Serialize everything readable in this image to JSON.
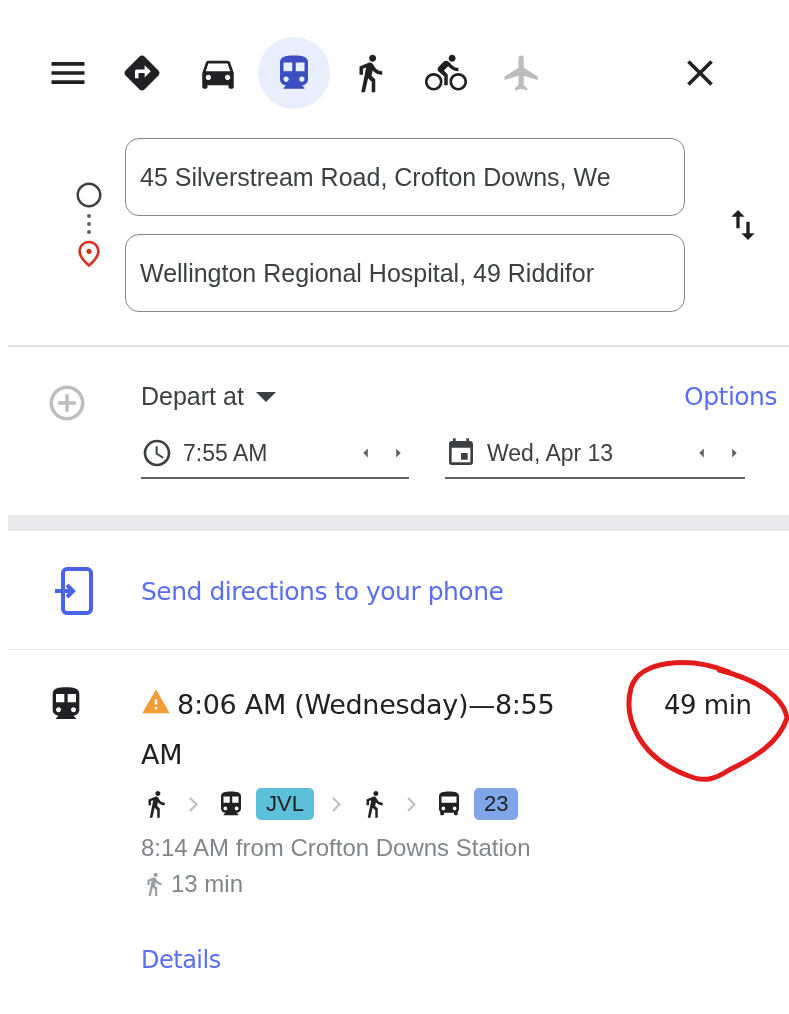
{
  "travel_modes": [
    {
      "kind": "best",
      "selected": false,
      "disabled": false
    },
    {
      "kind": "car",
      "selected": false,
      "disabled": false
    },
    {
      "kind": "transit",
      "selected": true,
      "disabled": false
    },
    {
      "kind": "walk",
      "selected": false,
      "disabled": false
    },
    {
      "kind": "bike",
      "selected": false,
      "disabled": false
    },
    {
      "kind": "flight",
      "selected": false,
      "disabled": true
    }
  ],
  "origin": {
    "value": "45 Silverstream Road, Crofton Downs, We"
  },
  "destination": {
    "value": "Wellington Regional Hospital, 49 Riddifor"
  },
  "depart": {
    "label": "Depart at",
    "options": "Options",
    "time": "7:55 AM",
    "date": "Wed, Apr 13"
  },
  "send_link": "Send directions to your phone",
  "route": {
    "title": "8:06 AM (Wednesday)—8:55 AM",
    "warning": true,
    "duration": "49 min",
    "steps": [
      {
        "kind": "walk"
      },
      {
        "kind": "train",
        "badge": "JVL",
        "color": "#5bc0d8"
      },
      {
        "kind": "walk"
      },
      {
        "kind": "bus",
        "badge": "23",
        "color": "#7fa6e8"
      }
    ],
    "departure": "8:14 AM from Crofton Downs Station",
    "walk_time": "13 min",
    "details": "Details"
  }
}
